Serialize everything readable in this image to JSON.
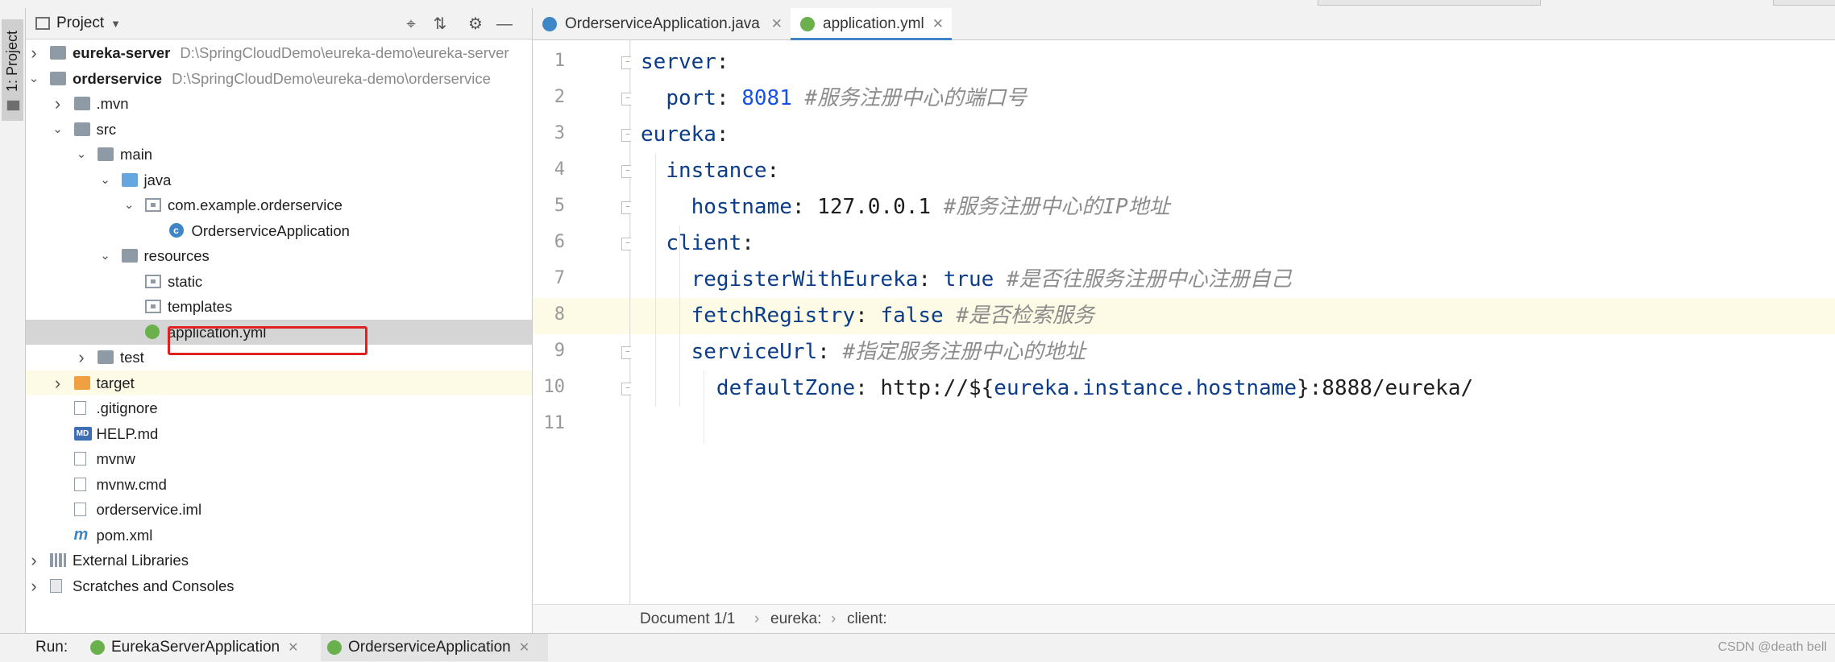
{
  "tool_window": {
    "stripe_label": "1: Project"
  },
  "project_panel": {
    "title": "Project",
    "tree": [
      {
        "label": "eureka-server",
        "path": "D:\\SpringCloudDemo\\eureka-demo\\eureka-server",
        "icon": "module-folder",
        "depth": 0,
        "expand": "collapsed",
        "bold": true
      },
      {
        "label": "orderservice",
        "path": "D:\\SpringCloudDemo\\eureka-demo\\orderservice",
        "icon": "module-folder",
        "depth": 0,
        "expand": "expanded",
        "bold": true
      },
      {
        "label": ".mvn",
        "icon": "folder",
        "depth": 1,
        "expand": "collapsed"
      },
      {
        "label": "src",
        "icon": "folder",
        "depth": 1,
        "expand": "expanded"
      },
      {
        "label": "main",
        "icon": "folder",
        "depth": 2,
        "expand": "expanded"
      },
      {
        "label": "java",
        "icon": "source-folder",
        "depth": 3,
        "expand": "expanded"
      },
      {
        "label": "com.example.orderservice",
        "icon": "package",
        "depth": 4,
        "expand": "expanded"
      },
      {
        "label": "OrderserviceApplication",
        "icon": "spring-boot-class",
        "depth": 5,
        "expand": "none"
      },
      {
        "label": "resources",
        "icon": "resources-folder",
        "depth": 3,
        "expand": "expanded"
      },
      {
        "label": "static",
        "icon": "package",
        "depth": 4,
        "expand": "none"
      },
      {
        "label": "templates",
        "icon": "package",
        "depth": 4,
        "expand": "none"
      },
      {
        "label": "application.yml",
        "icon": "spring-yml",
        "depth": 4,
        "expand": "none",
        "selected": true
      },
      {
        "label": "test",
        "icon": "folder",
        "depth": 2,
        "expand": "collapsed"
      },
      {
        "label": "target",
        "icon": "excluded-folder",
        "depth": 1,
        "expand": "collapsed",
        "ignored": true
      },
      {
        "label": ".gitignore",
        "icon": "text-file",
        "depth": 1,
        "expand": "none"
      },
      {
        "label": "HELP.md",
        "icon": "md-file",
        "depth": 1,
        "expand": "none"
      },
      {
        "label": "mvnw",
        "icon": "text-file",
        "depth": 1,
        "expand": "none"
      },
      {
        "label": "mvnw.cmd",
        "icon": "text-file",
        "depth": 1,
        "expand": "none"
      },
      {
        "label": "orderservice.iml",
        "icon": "iml-file",
        "depth": 1,
        "expand": "none"
      },
      {
        "label": "pom.xml",
        "icon": "maven-file",
        "depth": 1,
        "expand": "none"
      },
      {
        "label": "External Libraries",
        "icon": "libraries",
        "depth": 0,
        "expand": "collapsed"
      },
      {
        "label": "Scratches and Consoles",
        "icon": "scratches",
        "depth": 0,
        "expand": "collapsed"
      }
    ]
  },
  "editor": {
    "tabs": [
      {
        "label": "OrderserviceApplication.java",
        "icon": "spring-boot-class",
        "active": false
      },
      {
        "label": "application.yml",
        "icon": "spring-yml",
        "active": true
      }
    ],
    "current_line": 8,
    "lines": [
      {
        "n": "1",
        "tokens": [
          {
            "t": "k",
            "s": "server"
          },
          {
            "t": "v",
            "s": ":"
          }
        ]
      },
      {
        "n": "2",
        "tokens": [
          {
            "t": "v",
            "s": "  "
          },
          {
            "t": "k",
            "s": "port"
          },
          {
            "t": "v",
            "s": ": "
          },
          {
            "t": "num",
            "s": "8081"
          },
          {
            "t": "v",
            "s": " "
          },
          {
            "t": "cm",
            "s": "#服务注册中心的端口号"
          }
        ]
      },
      {
        "n": "3",
        "tokens": [
          {
            "t": "k",
            "s": "eureka"
          },
          {
            "t": "v",
            "s": ":"
          }
        ]
      },
      {
        "n": "4",
        "tokens": [
          {
            "t": "v",
            "s": "  "
          },
          {
            "t": "k",
            "s": "instance"
          },
          {
            "t": "v",
            "s": ":"
          }
        ]
      },
      {
        "n": "5",
        "tokens": [
          {
            "t": "v",
            "s": "    "
          },
          {
            "t": "k",
            "s": "hostname"
          },
          {
            "t": "v",
            "s": ": 127.0.0.1 "
          },
          {
            "t": "cm",
            "s": "#服务注册中心的IP地址"
          }
        ]
      },
      {
        "n": "6",
        "tokens": [
          {
            "t": "v",
            "s": "  "
          },
          {
            "t": "k",
            "s": "client"
          },
          {
            "t": "v",
            "s": ":"
          }
        ]
      },
      {
        "n": "7",
        "tokens": [
          {
            "t": "v",
            "s": "    "
          },
          {
            "t": "k",
            "s": "registerWithEureka"
          },
          {
            "t": "v",
            "s": ": "
          },
          {
            "t": "kw",
            "s": "true"
          },
          {
            "t": "v",
            "s": " "
          },
          {
            "t": "cm",
            "s": "#是否往服务注册中心注册自己"
          }
        ]
      },
      {
        "n": "8",
        "tokens": [
          {
            "t": "v",
            "s": "    "
          },
          {
            "t": "k",
            "s": "fetchRegistry"
          },
          {
            "t": "v",
            "s": ": "
          },
          {
            "t": "kw",
            "s": "false"
          },
          {
            "t": "v",
            "s": " "
          },
          {
            "t": "cm",
            "s": "#是否检索服务"
          }
        ]
      },
      {
        "n": "9",
        "tokens": [
          {
            "t": "v",
            "s": "    "
          },
          {
            "t": "k",
            "s": "serviceUrl"
          },
          {
            "t": "v",
            "s": ": "
          },
          {
            "t": "cm",
            "s": "#指定服务注册中心的地址"
          }
        ]
      },
      {
        "n": "10",
        "tokens": [
          {
            "t": "v",
            "s": "      "
          },
          {
            "t": "k",
            "s": "defaultZone"
          },
          {
            "t": "v",
            "s": ": http://${"
          },
          {
            "t": "k",
            "s": "eureka.instance.hostname"
          },
          {
            "t": "v",
            "s": "}:8888/eureka/"
          }
        ]
      },
      {
        "n": "11",
        "tokens": []
      }
    ],
    "breadcrumb": [
      "Document 1/1",
      "eureka:",
      "client:"
    ]
  },
  "run_bar": {
    "label": "Run:",
    "tabs": [
      {
        "label": "EurekaServerApplication",
        "active": false
      },
      {
        "label": "OrderserviceApplication",
        "active": true
      }
    ]
  },
  "watermark": "CSDN @death bell",
  "colors": {
    "accent": "#4083c9",
    "selection": "#d5d5d5",
    "current_line": "#fdfbe6",
    "highlight_box": "#e02020"
  }
}
